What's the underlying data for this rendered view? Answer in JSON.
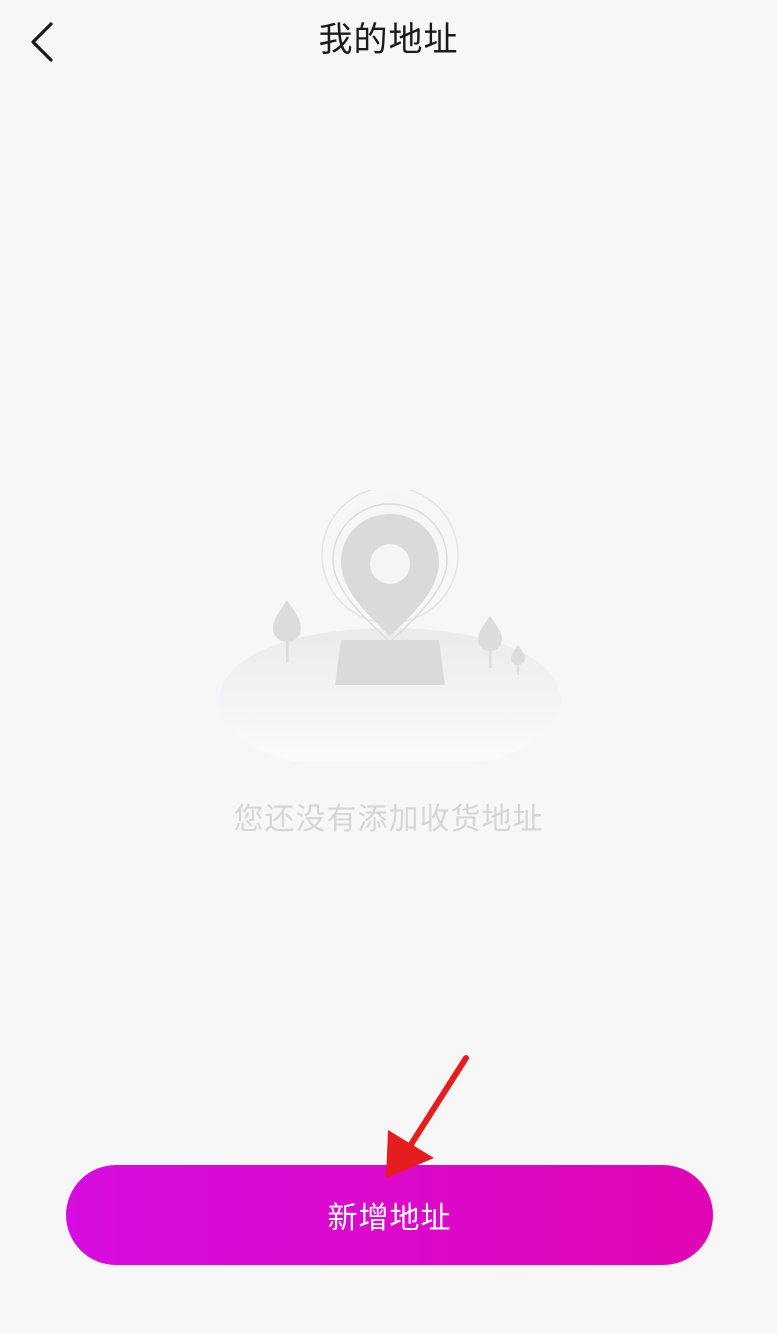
{
  "header": {
    "title": "我的地址",
    "back_icon": "chevron-left-icon"
  },
  "empty_state": {
    "illustration_icon": "map-pin-landscape-icon",
    "message": "您还没有添加收货地址"
  },
  "footer": {
    "add_button_label": "新增地址"
  },
  "colors": {
    "background": "#f7f7f8",
    "accent_start": "#d60ce0",
    "accent_end": "#e006b4",
    "annotation_arrow": "#e51d1d",
    "muted_text": "#d6d6d9"
  }
}
